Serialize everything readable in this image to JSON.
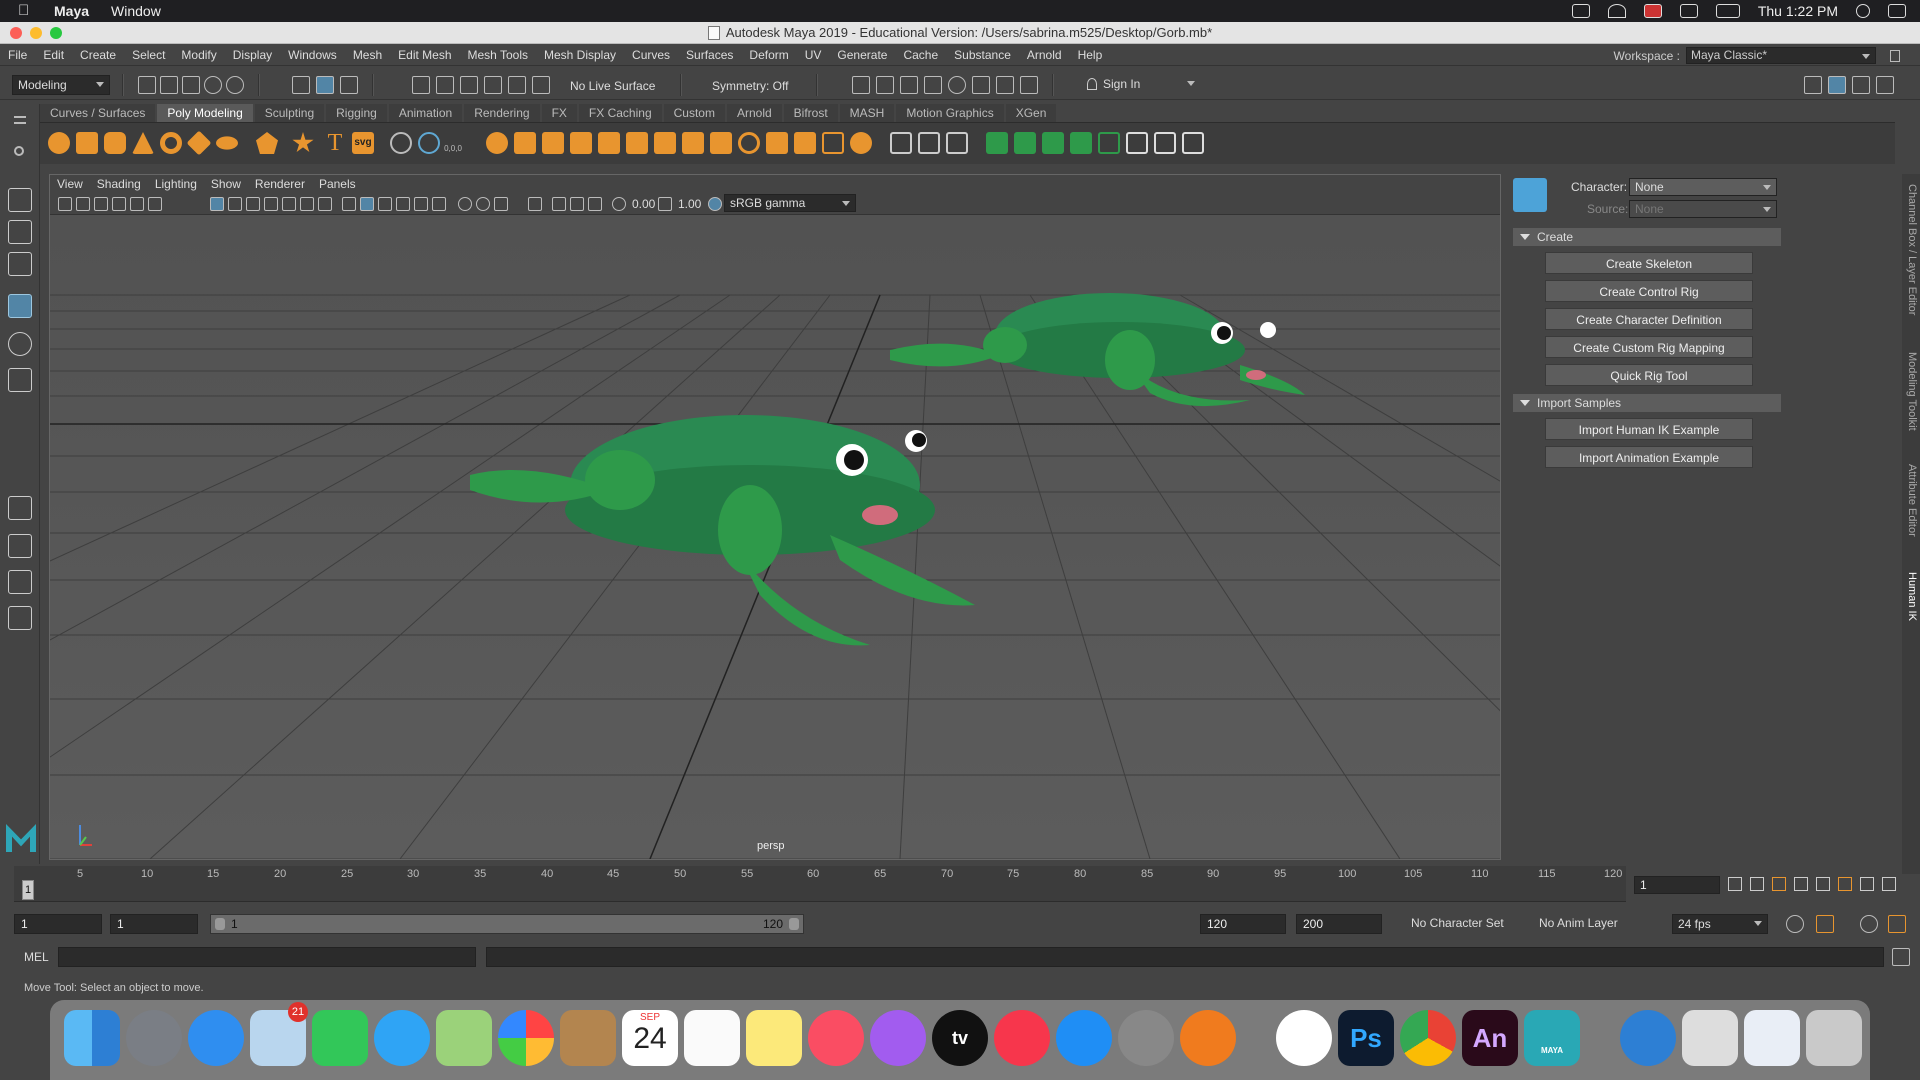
{
  "macbar": {
    "app_name": "Maya",
    "menus": [
      "Window"
    ],
    "clock": "Thu 1:22 PM"
  },
  "window": {
    "title": "Autodesk Maya 2019 - Educational Version: /Users/sabrina.m525/Desktop/Gorb.mb*"
  },
  "main_menu": [
    "File",
    "Edit",
    "Create",
    "Select",
    "Modify",
    "Display",
    "Windows",
    "Mesh",
    "Edit Mesh",
    "Mesh Tools",
    "Mesh Display",
    "Curves",
    "Surfaces",
    "Deform",
    "UV",
    "Generate",
    "Cache",
    "Substance",
    "Arnold",
    "Help"
  ],
  "workspace": {
    "label": "Workspace :",
    "value": "Maya Classic*"
  },
  "statusline": {
    "menu_set": "Modeling",
    "live_surface": "No Live Surface",
    "symmetry": "Symmetry: Off",
    "sign_in": "Sign In"
  },
  "shelf": {
    "tabs": [
      "Curves / Surfaces",
      "Poly Modeling",
      "Sculpting",
      "Rigging",
      "Animation",
      "Rendering",
      "FX",
      "FX Caching",
      "Custom",
      "Arnold",
      "Bifrost",
      "MASH",
      "Motion Graphics",
      "XGen"
    ],
    "active_tab": "Poly Modeling",
    "svg_label": "svg",
    "type_label": "T",
    "coords_label": "0,0,0"
  },
  "viewport": {
    "menus": [
      "View",
      "Shading",
      "Lighting",
      "Show",
      "Renderer",
      "Panels"
    ],
    "exposure": "0.00",
    "gamma": "1.00",
    "color_space": "sRGB gamma",
    "camera": "persp"
  },
  "human_ik": {
    "character_label": "Character:",
    "character_value": "None",
    "source_label": "Source:",
    "source_value": "None",
    "create_header": "Create",
    "create_buttons": [
      "Create Skeleton",
      "Create Control Rig",
      "Create Character Definition",
      "Create Custom Rig Mapping",
      "Quick Rig Tool"
    ],
    "import_header": "Import Samples",
    "import_buttons": [
      "Import Human IK Example",
      "Import Animation Example"
    ]
  },
  "side_tabs": [
    "Channel Box / Layer Editor",
    "Modeling Toolkit",
    "Attribute Editor",
    "Human IK"
  ],
  "time_slider": {
    "ticks": [
      "1",
      "5",
      "10",
      "15",
      "20",
      "25",
      "30",
      "35",
      "40",
      "45",
      "50",
      "55",
      "60",
      "65",
      "70",
      "75",
      "80",
      "85",
      "90",
      "95",
      "100",
      "105",
      "110",
      "115",
      "120"
    ],
    "current_frame": "1"
  },
  "range_slider": {
    "start_time": "1",
    "playback_start": "1",
    "range_start": "1",
    "range_end": "120",
    "playback_end": "120",
    "end_time": "200",
    "character_set": "No Character Set",
    "anim_layer": "No Anim Layer",
    "fps": "24 fps"
  },
  "command_line": {
    "language": "MEL"
  },
  "help_line": {
    "text": "Move Tool: Select an object to move."
  },
  "dock": {
    "mail_badge": "21",
    "calendar_month": "SEP",
    "calendar_day": "24",
    "apps": [
      "Finder",
      "Launchpad",
      "Safari",
      "Mail",
      "FaceTime",
      "Messages",
      "Maps",
      "Photos",
      "Contacts",
      "Calendar",
      "Reminders",
      "Notes",
      "Music",
      "Podcasts",
      "TV",
      "News",
      "App Store",
      "System Preferences",
      "Blender",
      "Wacom",
      "Photoshop",
      "Chrome",
      "Animate",
      "Maya",
      "Network",
      "Preview",
      "Screenshot",
      "Trash"
    ],
    "tv_label": "tv",
    "ps_label": "Ps",
    "an_label": "An",
    "maya_label": "MAYA"
  },
  "colors": {
    "accent": "#5285a6",
    "frog_green": "#2e9a4a",
    "frog_body": "#2f8c58",
    "tongue": "#d06c7c"
  }
}
